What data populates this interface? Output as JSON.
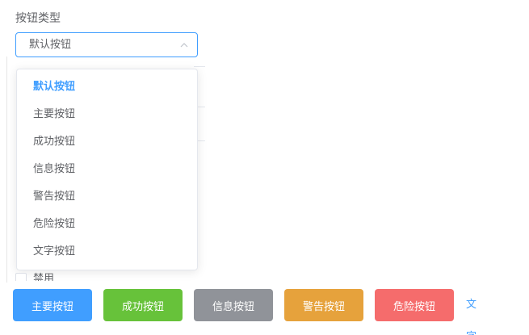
{
  "form": {
    "label": "按钮类型",
    "select": {
      "value": "默认按钮",
      "arrow_icon": "chevron-up-icon"
    }
  },
  "dropdown": {
    "options": [
      {
        "label": "默认按钮",
        "selected": true
      },
      {
        "label": "主要按钮",
        "selected": false
      },
      {
        "label": "成功按钮",
        "selected": false
      },
      {
        "label": "信息按钮",
        "selected": false
      },
      {
        "label": "警告按钮",
        "selected": false
      },
      {
        "label": "危险按钮",
        "selected": false
      },
      {
        "label": "文字按钮",
        "selected": false
      }
    ]
  },
  "disabled": {
    "label": "禁用",
    "checked": false
  },
  "buttons": {
    "primary": {
      "label": "主要按钮",
      "color": "#409eff"
    },
    "success": {
      "label": "成功按钮",
      "color": "#67c23a"
    },
    "info": {
      "label": "信息按钮",
      "color": "#909399"
    },
    "warning": {
      "label": "警告按钮",
      "color": "#e6a23c"
    },
    "danger": {
      "label": "危险按钮",
      "color": "#f56c6c"
    },
    "text": {
      "label": "文字按钮",
      "color": "#409eff"
    }
  },
  "colors": {
    "accent": "#409eff",
    "text": "#606266",
    "border": "#dcdfe6"
  }
}
